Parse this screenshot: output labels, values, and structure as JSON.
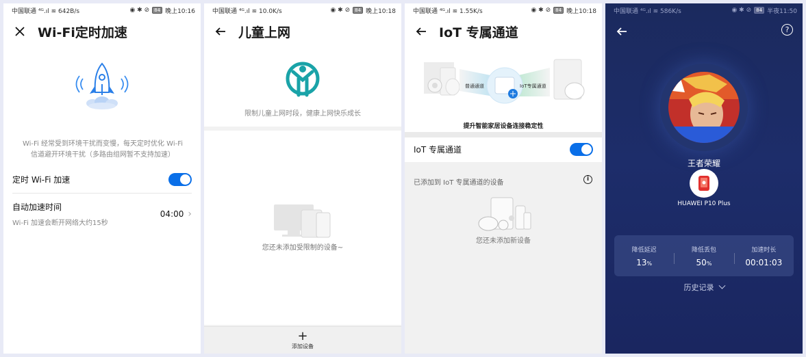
{
  "screens": [
    {
      "status": {
        "carrier": "中国联通",
        "speed": "642B/s",
        "battery": "84",
        "time": "晚上10:16"
      },
      "title": "Wi-Fi定时加速",
      "nav_icon": "close-icon",
      "description": "Wi-Fi 经常受到环境干扰而变慢，每天定时优化 Wi-Fi 信道避开环境干扰（多路由组网暂不支持加速）",
      "toggle_label": "定时 Wi-Fi 加速",
      "toggle_on": true,
      "auto_time_label": "自动加速时间",
      "auto_time_sub": "Wi-Fi 加速会断开网络大约15秒",
      "auto_time_value": "04:00"
    },
    {
      "status": {
        "carrier": "中国联通",
        "speed": "10.0K/s",
        "battery": "84",
        "time": "晚上10:18"
      },
      "title": "儿童上网",
      "nav_icon": "back-arrow-icon",
      "description": "限制儿童上网时段，健康上网快乐成长",
      "empty_text": "您还未添加受限制的设备~",
      "add_label": "添加设备"
    },
    {
      "status": {
        "carrier": "中国联通",
        "speed": "1.55K/s",
        "battery": "84",
        "time": "晚上10:18"
      },
      "title": "IoT 专属通道",
      "nav_icon": "back-arrow-icon",
      "illustration": {
        "normal_label": "普通通道",
        "iot_label": "IoT专属通道"
      },
      "caption": "提升智能家居设备连接稳定性",
      "toggle_label": "IoT 专属通道",
      "toggle_on": true,
      "added_label": "已添加到 IoT 专属通道的设备",
      "empty_text": "您还未添加新设备"
    },
    {
      "status": {
        "carrier": "中国联通",
        "speed": "586K/s",
        "battery": "84",
        "time": "半夜11:50"
      },
      "nav_icon": "back-arrow-icon",
      "game_name": "王者荣耀",
      "device_name": "HUAWEI P10 Plus",
      "stats": [
        {
          "label": "降低延迟",
          "value": "13",
          "unit": "%"
        },
        {
          "label": "降低丢包",
          "value": "50",
          "unit": "%"
        },
        {
          "label": "加速时长",
          "value": "00:01:03",
          "unit": ""
        }
      ],
      "history_label": "历史记录"
    }
  ],
  "colors": {
    "accent": "#0a6fe8",
    "teal": "#1aa3a8",
    "dark_bg": "#1d2d6a"
  }
}
